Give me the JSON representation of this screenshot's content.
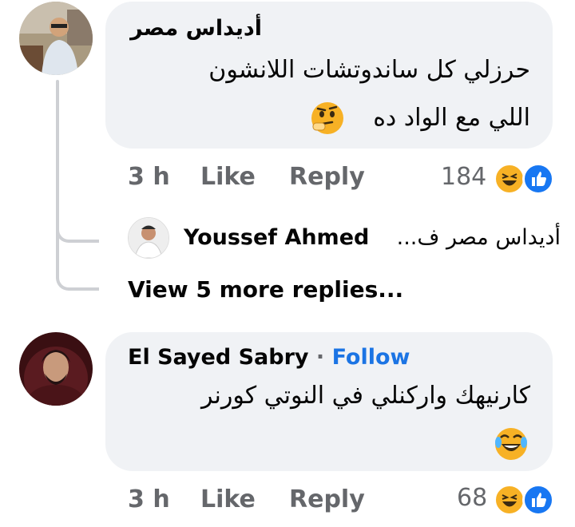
{
  "colors": {
    "bubble": "#f0f2f5",
    "secondary_text": "#65676b",
    "link_blue": "#1b74e4",
    "like_blue": "#1877f2",
    "haha_yellow": "#f7b125"
  },
  "comments": [
    {
      "author": "أديداس مصر",
      "lines": [
        "حرزلي كل ساندوتشات اللانشون",
        "اللي مع الواد ده"
      ],
      "emoji": "thinking-face-icon",
      "time": "3 h",
      "like": "Like",
      "reply": "Reply",
      "reaction_count": "184",
      "reactions": [
        "haha-icon",
        "like-icon"
      ]
    },
    {
      "author": "El Sayed Sabry",
      "separator": "·",
      "follow": "Follow",
      "lines": [
        "كارنيهك واركنلي في النوتي كورنر"
      ],
      "emoji": "tears-of-joy-icon",
      "time": "3 h",
      "like": "Like",
      "reply": "Reply",
      "reaction_count": "68",
      "reactions": [
        "haha-icon",
        "like-icon"
      ]
    }
  ],
  "reply_preview": {
    "author": "Youssef Ahmed",
    "snippet": "أديداس مصر ف..."
  },
  "view_more": "View 5 more replies..."
}
